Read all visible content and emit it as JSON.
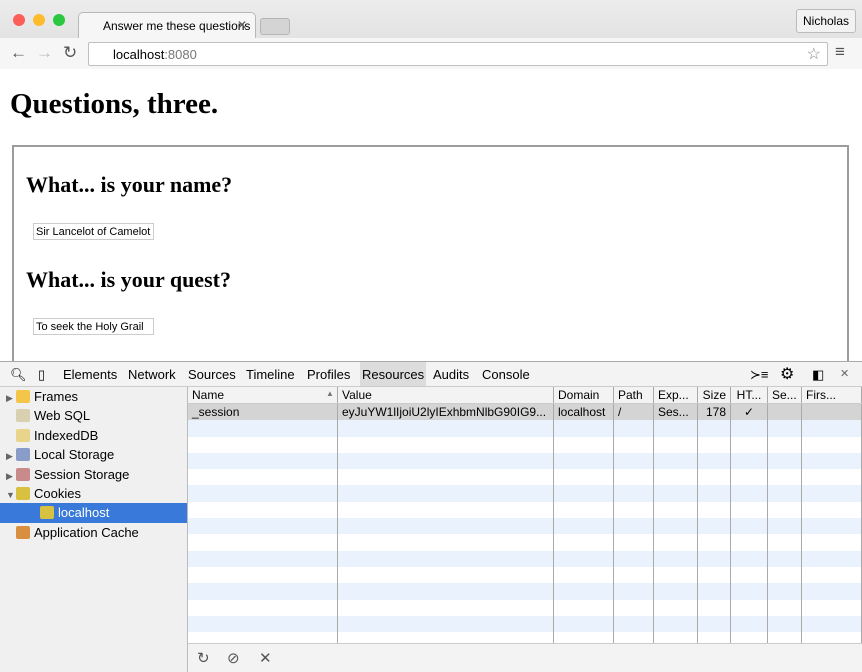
{
  "browser": {
    "tab_title": "Answer me these questions",
    "user": "Nicholas",
    "url_host": "localhost",
    "url_port": ":8080"
  },
  "page": {
    "title": "Questions, three.",
    "q1": "What... is your name?",
    "a1": "Sir Lancelot of Camelot",
    "q2": "What... is your quest?",
    "a2": "To seek the Holy Grail"
  },
  "devtools": {
    "tabs": [
      "Elements",
      "Network",
      "Sources",
      "Timeline",
      "Profiles",
      "Resources",
      "Audits",
      "Console"
    ],
    "active_tab": "Resources",
    "sidebar": [
      {
        "label": "Frames",
        "icon": "folder-icon",
        "color": "#f3c64a",
        "expand": "▶"
      },
      {
        "label": "Web SQL",
        "icon": "database-icon",
        "color": "#d8d0b0",
        "expand": ""
      },
      {
        "label": "IndexedDB",
        "icon": "database-icon",
        "color": "#e8d48a",
        "expand": ""
      },
      {
        "label": "Local Storage",
        "icon": "storage-grid-icon",
        "color": "#8a9cc8",
        "expand": "▶"
      },
      {
        "label": "Session Storage",
        "icon": "storage-grid-icon",
        "color": "#c88a8a",
        "expand": "▶"
      },
      {
        "label": "Cookies",
        "icon": "cookie-icon",
        "color": "#d8c040",
        "expand": "▼"
      },
      {
        "label": "localhost",
        "icon": "cookie-icon",
        "color": "#d8c040",
        "expand": "",
        "active": true,
        "indent": true
      },
      {
        "label": "Application Cache",
        "icon": "grid-icon",
        "color": "#d89040",
        "expand": ""
      }
    ],
    "columns": [
      "Name",
      "Value",
      "Domain",
      "Path",
      "Exp...",
      "Size",
      "HT...",
      "Se...",
      "Firs..."
    ],
    "rows": [
      [
        "_session",
        "eyJuYW1lIjoiU2lyIExhbmNlbG90IG9...",
        "localhost",
        "/",
        "Ses...",
        "178",
        "✓",
        "",
        ""
      ]
    ]
  }
}
